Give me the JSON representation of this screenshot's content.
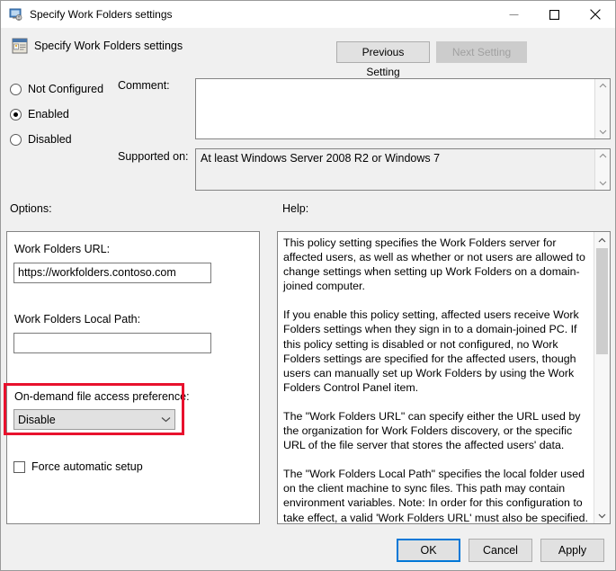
{
  "window": {
    "title": "Specify Work Folders settings",
    "icon": "policy-setting-icon",
    "minimize_label": "Minimize",
    "maximize_label": "Maximize",
    "close_label": "Close"
  },
  "header": {
    "title": "Specify Work Folders settings",
    "icon": "policy-document-icon",
    "previous_setting": "Previous Setting",
    "next_setting": "Next Setting"
  },
  "state": {
    "options": [
      {
        "label": "Not Configured",
        "selected": false
      },
      {
        "label": "Enabled",
        "selected": true
      },
      {
        "label": "Disabled",
        "selected": false
      }
    ]
  },
  "comment": {
    "label": "Comment:",
    "value": "",
    "placeholder": ""
  },
  "supported_on": {
    "label": "Supported on:",
    "value": "At least Windows Server 2008 R2 or Windows 7"
  },
  "sections": {
    "options_label": "Options:",
    "help_label": "Help:"
  },
  "options": {
    "url_label": "Work Folders URL:",
    "url_value": "https://workfolders.contoso.com",
    "local_path_label": "Work Folders Local Path:",
    "local_path_value": "",
    "ondemand_label": "On-demand file access preference:",
    "ondemand_value": "Disable",
    "ondemand_options": [
      "Disable"
    ],
    "force_auto_label": "Force automatic setup",
    "force_auto_checked": false,
    "highlight_color": "#e8112d"
  },
  "help": {
    "paragraphs": [
      "This policy setting specifies the Work Folders server for affected users, as well as whether or not users are allowed to change settings when setting up Work Folders on a domain-joined computer.",
      "If you enable this policy setting, affected users receive Work Folders settings when they sign in to a domain-joined PC. If this policy setting is disabled or not configured, no Work Folders settings are specified for the affected users, though users can manually set up Work Folders by using the Work Folders Control Panel item.",
      "The \"Work Folders URL\" can specify either the URL used by the organization for Work Folders discovery, or the specific URL of the file server that stores the affected users' data.",
      "The \"Work Folders Local Path\" specifies the local folder used on the client machine to sync files. This path may contain environment variables. Note: In order for this configuration to take effect, a valid 'Work Folders URL' must also be specified."
    ]
  },
  "buttons": {
    "ok": "OK",
    "cancel": "Cancel",
    "apply": "Apply"
  }
}
